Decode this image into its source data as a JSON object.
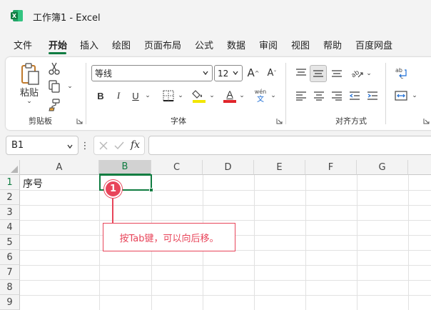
{
  "window": {
    "title": "工作簿1  -  Excel",
    "app_icon": "excel-icon"
  },
  "menu": {
    "tabs": [
      {
        "label": "文件"
      },
      {
        "label": "开始",
        "active": true
      },
      {
        "label": "插入"
      },
      {
        "label": "绘图"
      },
      {
        "label": "页面布局"
      },
      {
        "label": "公式"
      },
      {
        "label": "数据"
      },
      {
        "label": "审阅"
      },
      {
        "label": "视图"
      },
      {
        "label": "帮助"
      },
      {
        "label": "百度网盘"
      }
    ]
  },
  "ribbon": {
    "clipboard": {
      "paste_label": "粘贴",
      "group_label": "剪贴板",
      "icons": [
        "paste-icon",
        "cut-icon",
        "copy-icon",
        "format-painter-icon"
      ]
    },
    "font": {
      "group_label": "字体",
      "font_name": "等线",
      "font_size": "12",
      "increase_label": "A",
      "decrease_label": "A",
      "bold_label": "B",
      "italic_label": "I",
      "underline_label": "U",
      "color_letter": "A",
      "phonetic_top": "wén",
      "phonetic_bottom": "文",
      "colors": {
        "fill": "#f2e600",
        "font": "#e0242a"
      }
    },
    "alignment": {
      "group_label": "对齐方式",
      "icons": [
        "align-top-icon",
        "align-middle-icon",
        "align-bottom-icon",
        "orientation-icon",
        "align-left-icon",
        "center-icon",
        "align-right-icon",
        "decrease-indent-icon",
        "increase-indent-icon",
        "wrap-text-icon",
        "merge-center-icon"
      ],
      "wrap_label": "ab c"
    }
  },
  "formula_bar": {
    "name_box": "B1",
    "formula": "",
    "fx_label": "fx"
  },
  "grid": {
    "columns": [
      "A",
      "B",
      "C",
      "D",
      "E",
      "F",
      "G"
    ],
    "selected_column": "B",
    "rows": [
      "1",
      "2",
      "3",
      "4",
      "5",
      "6",
      "7",
      "8",
      "9"
    ],
    "selected_row": "1",
    "cells": {
      "A1": "序号"
    },
    "active_cell": "B1"
  },
  "callout": {
    "step": "1",
    "text": "按Tab键，可以向后移。",
    "color": "#e8455a"
  },
  "colors": {
    "accent": "#107c41",
    "ribbon_bg": "#ffffff",
    "window_bg": "#f3f3f3"
  }
}
